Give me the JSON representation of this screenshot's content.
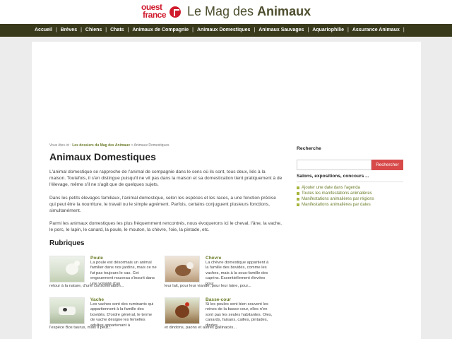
{
  "header": {
    "logo_line1": "ouest",
    "logo_line2": "france",
    "site_title_prefix": "Le Mag des ",
    "site_title_bold": "Animaux"
  },
  "nav": {
    "items": [
      "Accueil",
      "Brèves",
      "Chiens",
      "Chats",
      "Animaux de Compagnie",
      "Animaux Domestiques",
      "Animaux Sauvages",
      "Aquariophilie",
      "Assurance Animaux"
    ],
    "separator": "|"
  },
  "breadcrumb": {
    "prefix": "Vous êtes ici : ",
    "link": "Les dossiers du Mag des Animaux",
    "separator": " > ",
    "current": "Animaux Domestiques"
  },
  "main": {
    "title": "Animaux Domestiques",
    "paragraphs": [
      "L'animal domestique se rapproche de l'animal de compagnie dans le sens où ils sont, tous deux, liés à la maison. Toutefois, il s'en distingue puisqu'il ne vit pas dans la maison et sa domestication tient pratiquement à de l'élevage, même s'il ne s'agit que de quelques sujets.",
      "Dans les petits élevages familiaux, l'animal domestique, selon les espèces et les races, a une fonction précise qui peut être la nourriture, le travail ou le simple agrément. Parfois, certains conjuguent plusieurs fonctions, simultanément.",
      "Parmi les animaux domestiques les plus fréquemment rencontrés, nous évoquerons ici le cheval, l'âne, la vache, le porc, le lapin, le canard, la poule, le mouton, la chèvre, l'oie, la pintade, etc."
    ],
    "rubriques_title": "Rubriques",
    "rubriques": [
      {
        "title": "Poule",
        "text": "La poule est désormais un animal familier dans nos jardins, mais ce ne fut pas toujours le cas. Cet engouement nouveau s'inscrit dans une volonté d'un",
        "text_wrap": "retour à la nature, d'une consommation..."
      },
      {
        "title": "Chèvre",
        "text": "La chèvre domestique appartient à la famille des bovidés, comme les vaches, mais à la sous-famille des caprins. Essentiellement élevées pour",
        "text_wrap": "leur lait, pour leur viande, pour leur laine, pour..."
      },
      {
        "title": "Vache",
        "text": "Les vaches sont des ruminants qui appartiennent à la famille des bovidés. D'ordre général, le terme de vache désigne les femelles adultes appartenant à",
        "text_wrap": "l'espèce Bos taurus, mais il peut..."
      },
      {
        "title": "Basse-cour",
        "text": "Si les poules sont bien souvent les reines de la basse-cour, elles n'en sont pas les seules habitantes. Oies, canards, faisans, cailles, pintades, dindes",
        "text_wrap": "et dindons, paons et autres gallinacés..."
      }
    ]
  },
  "sidebar": {
    "search_title": "Recherche",
    "search_value": "",
    "search_button": "Rechercher",
    "events_title": "Salons, expositions, concours ...",
    "events_links": [
      "Ajouter une date dans l'agenda",
      "Toutes les manifestations animalières",
      "Manifestations animalières par régions",
      "Manifestations animalières par dates"
    ]
  },
  "colors": {
    "nav_bg": "#39391c",
    "accent_green": "#6b7d2b",
    "brand_red": "#cf1a2c",
    "search_button": "#d84a4a"
  }
}
